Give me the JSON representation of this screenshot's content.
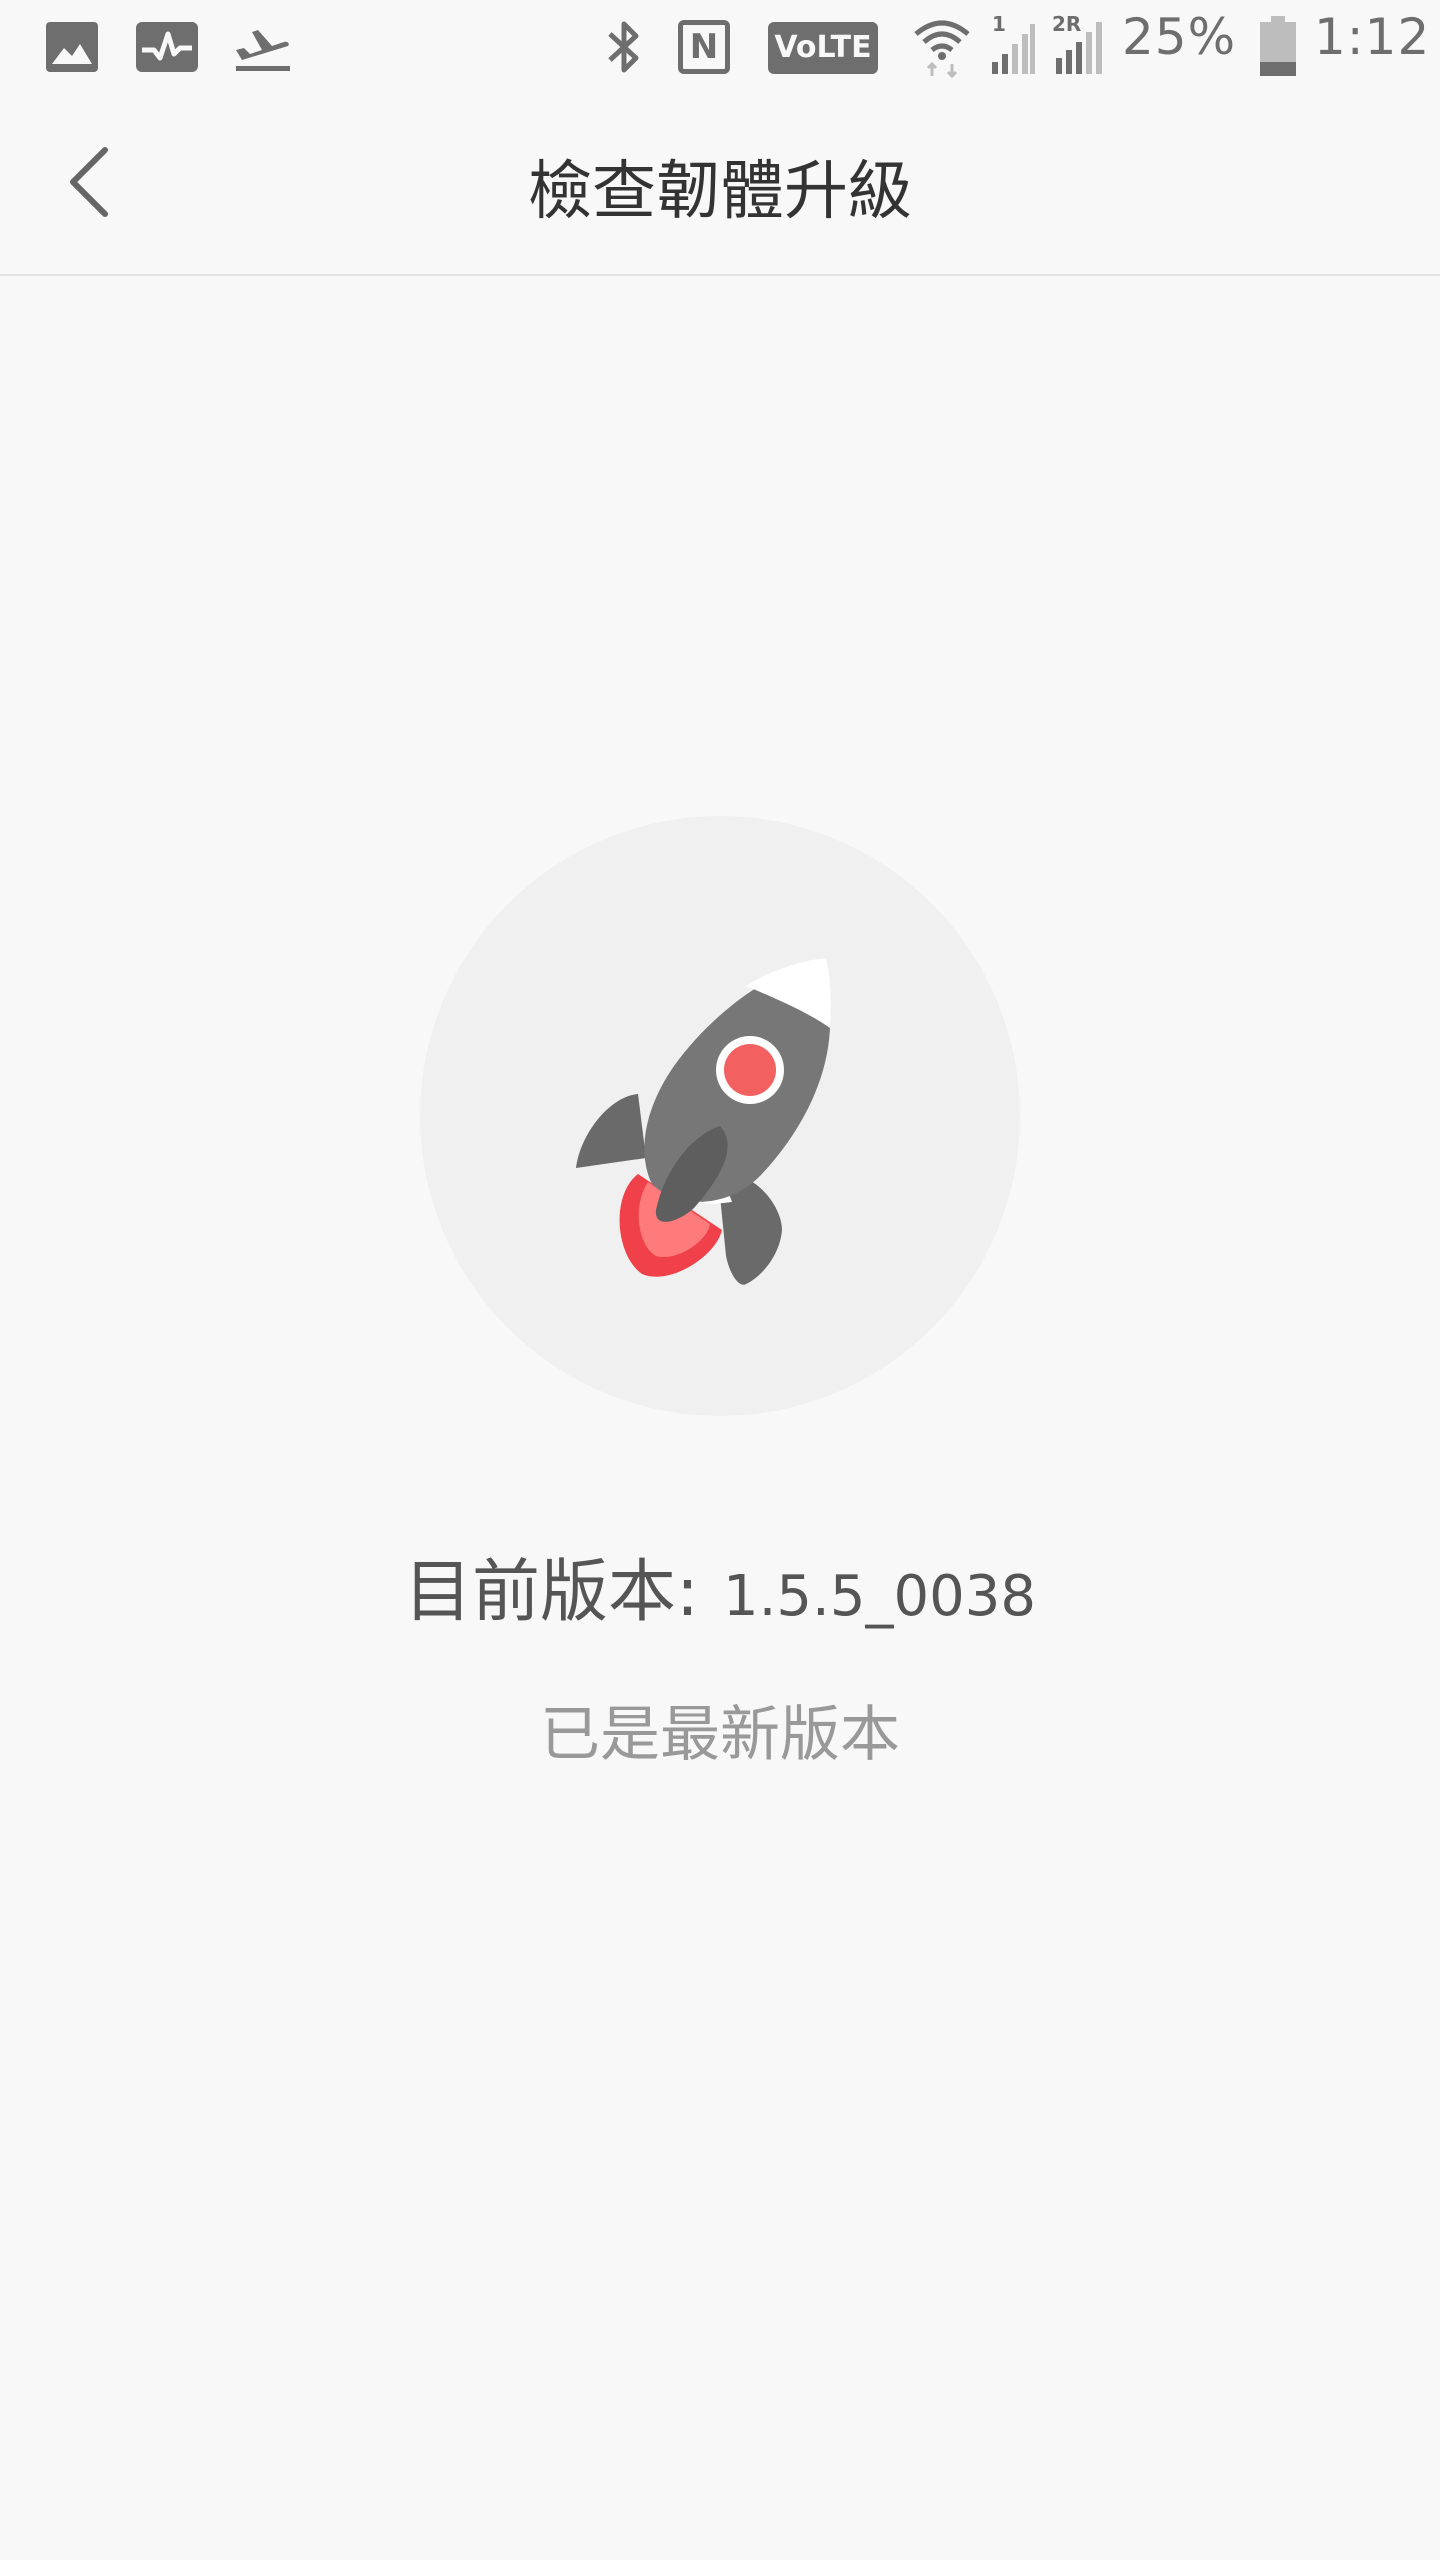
{
  "status_bar": {
    "battery_percent": "25%",
    "time": "1:12",
    "volte_label": "VoLTE",
    "sim1_label": "1",
    "sim2_label": "2R",
    "nfc_label": "N",
    "left_icons": [
      "image-icon",
      "activity-icon",
      "airplane-takeoff-icon"
    ],
    "right_icons": [
      "bluetooth-icon",
      "nfc-icon",
      "volte-icon",
      "wifi-icon",
      "signal-sim1-icon",
      "signal-sim2-icon",
      "battery-icon"
    ]
  },
  "header": {
    "title": "檢查韌體升級",
    "back_icon": "chevron-left-icon"
  },
  "main": {
    "illustration_icon": "rocket-icon",
    "version_label": "目前版本:",
    "version_value": "1.5.5_0038",
    "status_text": "已是最新版本"
  },
  "colors": {
    "background": "#f8f8f8",
    "circle": "#f0f0f0",
    "rocket_body": "#777777",
    "rocket_window": "#f26060",
    "flame": "#f0404a"
  }
}
